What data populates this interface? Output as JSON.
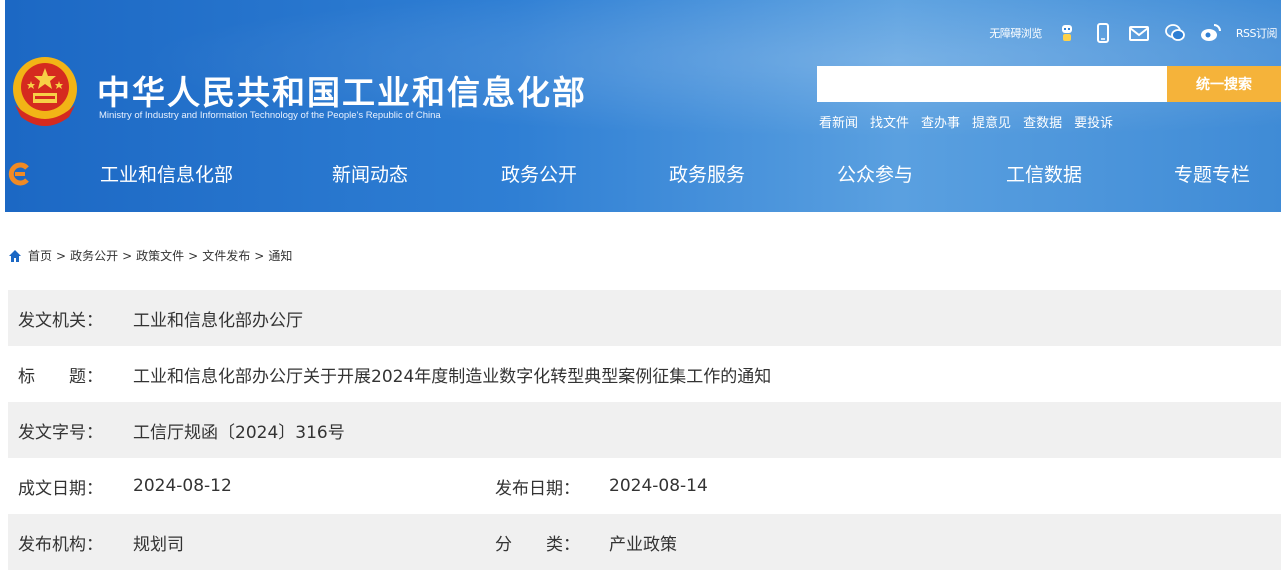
{
  "header": {
    "title": "中华人民共和国工业和信息化部",
    "subtitle": "Ministry of Industry and Information Technology of the People's Republic of China",
    "utility": {
      "accessibility_label": "无障碍浏览",
      "rss_label": "RSS订阅",
      "icons": [
        "robot-icon",
        "mobile-icon",
        "mail-icon",
        "wechat-icon",
        "weibo-icon"
      ]
    },
    "search": {
      "placeholder": "",
      "button_label": "统一搜索"
    },
    "quick_links": [
      "看新闻",
      "找文件",
      "查办事",
      "提意见",
      "查数据",
      "要投诉"
    ]
  },
  "nav": {
    "items": [
      "工业和信息化部",
      "新闻动态",
      "政务公开",
      "政务服务",
      "公众参与",
      "工信数据",
      "专题专栏"
    ]
  },
  "breadcrumb": [
    "首页",
    "政务公开",
    "政策文件",
    "文件发布",
    "通知"
  ],
  "meta": {
    "issuer_label": "发文机关：",
    "issuer": "工业和信息化部办公厅",
    "title_label": "标　　题：",
    "title": "工业和信息化部办公厅关于开展2024年度制造业数字化转型典型案例征集工作的通知",
    "doc_no_label": "发文字号：",
    "doc_no": "工信厅规函〔2024〕316号",
    "written_date_label": "成文日期：",
    "written_date": "2024-08-12",
    "publish_date_label": "发布日期：",
    "publish_date": "2024-08-14",
    "publisher_label": "发布机构：",
    "publisher": "规划司",
    "category_label": "分　　类：",
    "category": "产业政策"
  },
  "colors": {
    "header_blue": "#2f7fd4",
    "search_button": "#f5b33a",
    "row_alt": "#f0f0f0"
  }
}
